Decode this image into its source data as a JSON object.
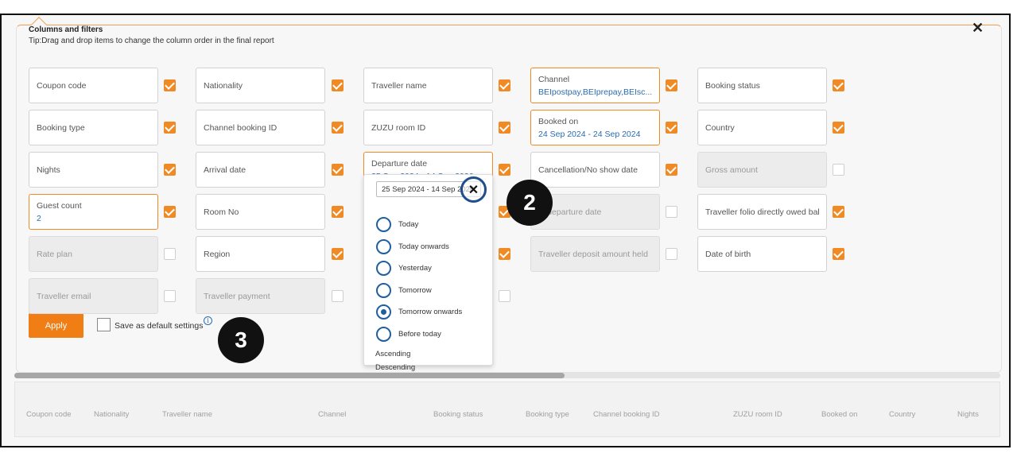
{
  "dialog": {
    "title": "Columns and filters",
    "tip": "Tip:Drag and drop items to change the column order in the final report",
    "close_icon": "close-icon"
  },
  "columns": [
    {
      "label": "Coupon code",
      "checked": true,
      "active": false,
      "disabled": false
    },
    {
      "label": "Nationality",
      "checked": true,
      "active": false,
      "disabled": false
    },
    {
      "label": "Traveller name",
      "checked": true,
      "active": false,
      "disabled": false
    },
    {
      "label": "Channel",
      "value": "BEIpostpay,BEIprepay,BEIsc...",
      "checked": true,
      "active": true,
      "disabled": false
    },
    {
      "label": "Booking status",
      "checked": true,
      "active": false,
      "disabled": false
    },
    {
      "label": "Booking type",
      "checked": true,
      "active": false,
      "disabled": false
    },
    {
      "label": "Channel booking ID",
      "checked": true,
      "active": false,
      "disabled": false
    },
    {
      "label": "ZUZU room ID",
      "checked": true,
      "active": false,
      "disabled": false
    },
    {
      "label": "Booked on",
      "value": "24 Sep 2024 - 24 Sep 2024",
      "checked": true,
      "active": true,
      "disabled": false
    },
    {
      "label": "Country",
      "checked": true,
      "active": false,
      "disabled": false
    },
    {
      "label": "Nights",
      "checked": true,
      "active": false,
      "disabled": false
    },
    {
      "label": "Arrival date",
      "checked": true,
      "active": false,
      "disabled": false
    },
    {
      "label": "Departure date",
      "value": "25 Sep 2024 - 14 Sep 2026",
      "checked": true,
      "active": true,
      "disabled": false
    },
    {
      "label": "Cancellation/No show date",
      "checked": true,
      "active": false,
      "disabled": false
    },
    {
      "label": "Gross amount",
      "checked": false,
      "active": false,
      "disabled": true
    },
    {
      "label": "Guest count",
      "value": "2",
      "checked": true,
      "active": true,
      "disabled": false
    },
    {
      "label": "Room No",
      "checked": true,
      "active": false,
      "disabled": false
    },
    {
      "label": "",
      "checked": true,
      "active": false,
      "disabled": false
    },
    {
      "label": "al departure date",
      "checked": false,
      "active": false,
      "disabled": true
    },
    {
      "label": "Traveller folio directly owed balan",
      "checked": true,
      "active": false,
      "disabled": false
    },
    {
      "label": "Rate plan",
      "checked": false,
      "active": false,
      "disabled": true
    },
    {
      "label": "Region",
      "checked": true,
      "active": false,
      "disabled": false
    },
    {
      "label": "",
      "checked": true,
      "active": false,
      "disabled": false
    },
    {
      "label": "Traveller deposit amount held",
      "checked": false,
      "active": false,
      "disabled": true
    },
    {
      "label": "Date of birth",
      "checked": true,
      "active": false,
      "disabled": false
    },
    {
      "label": "Traveller email",
      "checked": false,
      "active": false,
      "disabled": true
    },
    {
      "label": "Traveller payment",
      "checked": false,
      "active": false,
      "disabled": true
    },
    {
      "label": "",
      "checked": false,
      "active": false,
      "disabled": false
    }
  ],
  "actions": {
    "apply_label": "Apply",
    "save_default_label": "Save as default settings",
    "info_glyph": "i"
  },
  "badges": {
    "two": "2",
    "three": "3"
  },
  "date_dropdown": {
    "input_value": "25 Sep 2024 - 14 Sep 2026",
    "clear_glyph": "✕",
    "options": [
      {
        "label": "Today",
        "selected": false
      },
      {
        "label": "Today onwards",
        "selected": false
      },
      {
        "label": "Yesterday",
        "selected": false
      },
      {
        "label": "Tomorrow",
        "selected": false
      },
      {
        "label": "Tomorrow onwards",
        "selected": true
      },
      {
        "label": "Before today",
        "selected": false
      }
    ],
    "sort_ascending": "Ascending",
    "sort_descending": "Descending"
  },
  "table": {
    "headers": [
      "Coupon code",
      "Nationality",
      "Traveller name",
      "Channel",
      "Booking status",
      "Booking type",
      "Channel booking ID",
      "ZUZU room ID",
      "Booked on",
      "Country",
      "Nights"
    ]
  },
  "colors": {
    "accent": "#f08a24",
    "link": "#2b6cb0",
    "radio": "#1f5fa0"
  }
}
